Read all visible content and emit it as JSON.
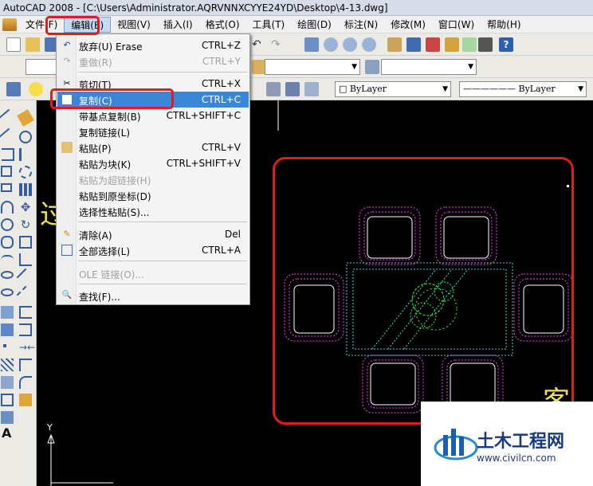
{
  "window": {
    "title": "AutoCAD 2008 - [C:\\Users\\Administrator.AQRVNNXCYYE24YD\\Desktop\\4-13.dwg]"
  },
  "menubar": {
    "items": [
      {
        "label": "文件(F)"
      },
      {
        "label": "编辑(E)"
      },
      {
        "label": "视图(V)"
      },
      {
        "label": "插入(I)"
      },
      {
        "label": "格式(O)"
      },
      {
        "label": "工具(T)"
      },
      {
        "label": "绘图(D)"
      },
      {
        "label": "标注(N)"
      },
      {
        "label": "修改(M)"
      },
      {
        "label": "窗口(W)"
      },
      {
        "label": "帮助(H)"
      }
    ]
  },
  "toolbar": {
    "layer_combo": "ByLayer",
    "linetype_combo": "ByLayer"
  },
  "edit_menu": {
    "items": [
      {
        "label": "放弃(U) Erase",
        "shortcut": "CTRL+Z",
        "icon": "undo-icon",
        "disabled": false
      },
      {
        "label": "重做(R)",
        "shortcut": "CTRL+Y",
        "icon": "redo-icon",
        "disabled": true
      },
      {
        "label": "剪切(T)",
        "shortcut": "CTRL+X",
        "icon": "cut-icon",
        "disabled": false
      },
      {
        "label": "复制(C)",
        "shortcut": "CTRL+C",
        "icon": "copy-icon",
        "disabled": false
      },
      {
        "label": "带基点复制(B)",
        "shortcut": "CTRL+SHIFT+C",
        "icon": "",
        "disabled": false
      },
      {
        "label": "复制链接(L)",
        "shortcut": "",
        "icon": "",
        "disabled": false
      },
      {
        "label": "粘贴(P)",
        "shortcut": "CTRL+V",
        "icon": "paste-icon",
        "disabled": false
      },
      {
        "label": "粘贴为块(K)",
        "shortcut": "CTRL+SHIFT+V",
        "icon": "",
        "disabled": false
      },
      {
        "label": "粘贴为超链接(H)",
        "shortcut": "",
        "icon": "",
        "disabled": true
      },
      {
        "label": "粘贴到原坐标(D)",
        "shortcut": "",
        "icon": "",
        "disabled": false
      },
      {
        "label": "选择性粘贴(S)...",
        "shortcut": "",
        "icon": "",
        "disabled": false
      },
      {
        "label": "清除(A)",
        "shortcut": "Del",
        "icon": "eraser-icon",
        "disabled": false
      },
      {
        "label": "全部选择(L)",
        "shortcut": "CTRL+A",
        "icon": "select-all-icon",
        "disabled": false
      },
      {
        "label": "OLE 链接(O)...",
        "shortcut": "",
        "icon": "",
        "disabled": true
      },
      {
        "label": "查找(F)...",
        "shortcut": "",
        "icon": "find-icon",
        "disabled": false
      }
    ]
  },
  "canvas": {
    "yellow_text_left": "过",
    "yellow_text_right": "客厅",
    "axis_y_label": "Y"
  },
  "watermark": {
    "title": "土木工程网",
    "url": "www.civilcn.com"
  },
  "colors": {
    "highlight": "#3a86d8",
    "annotation_red": "#e01c1c",
    "furniture_magenta": "#ff3cff",
    "table_cyan": "#33e0c8",
    "plant_green": "#34ff34",
    "text_yellow": "#f2e34a"
  }
}
